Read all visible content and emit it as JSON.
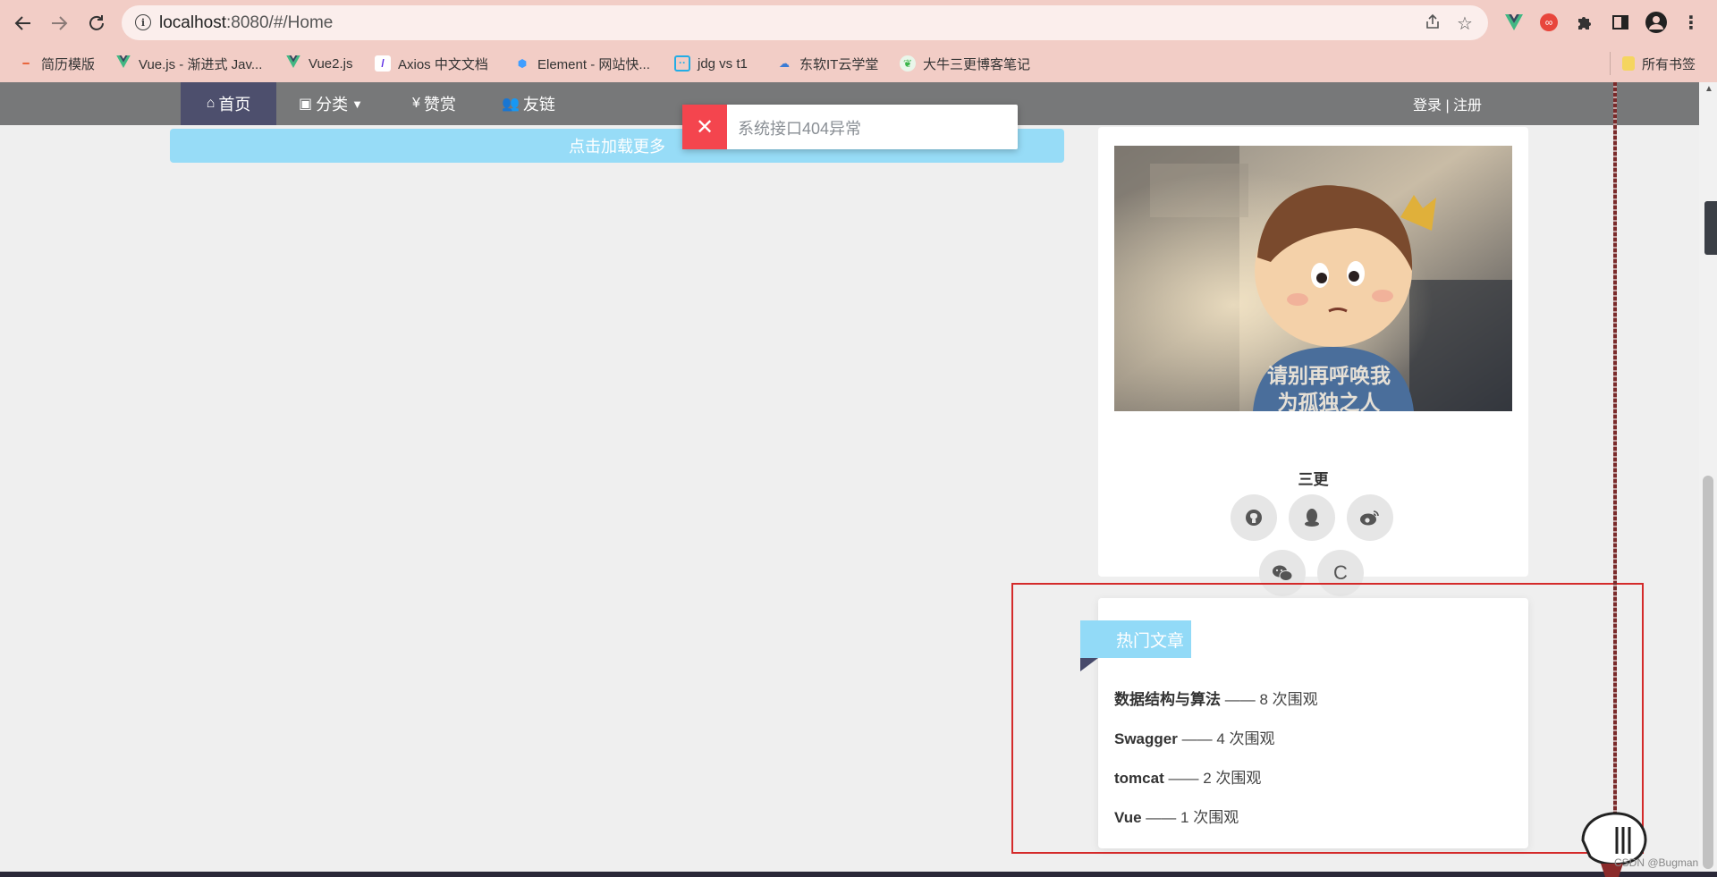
{
  "browser": {
    "url_host": "localhost",
    "url_rest": ":8080/#/Home",
    "bookmarks": [
      {
        "label": "简历模版",
        "icon": "dash-icon"
      },
      {
        "label": "Vue.js - 渐进式 Jav...",
        "icon": "vue-icon"
      },
      {
        "label": "Vue2.js",
        "icon": "vue-icon"
      },
      {
        "label": "Axios 中文文档",
        "icon": "axios-icon"
      },
      {
        "label": "Element - 网站快...",
        "icon": "element-icon"
      },
      {
        "label": "jdg vs t1",
        "icon": "bilibili-icon"
      },
      {
        "label": "东软IT云学堂",
        "icon": "cloud-icon"
      },
      {
        "label": "大牛三更博客笔记",
        "icon": "leaf-icon"
      }
    ],
    "all_bookmarks": "所有书签"
  },
  "nav": {
    "home": "首页",
    "category": "分类",
    "reward": "赞赏",
    "friends": "友链",
    "auth": "登录 | 注册"
  },
  "load_more": "点击加载更多",
  "toast": {
    "message": "系统接口404异常",
    "color": "#f4454e"
  },
  "profile": {
    "image_caption_line1": "请别再呼唤我",
    "image_caption_line2": "为孤独之人",
    "name": "三更",
    "socials": [
      "github-icon",
      "qq-icon",
      "weibo-icon",
      "wechat-icon",
      "csdn-icon"
    ],
    "csdn_label": "C"
  },
  "hot": {
    "title": "热门文章",
    "separator": " —— ",
    "unit": " 次围观",
    "items": [
      {
        "title": "数据结构与算法",
        "views": "8"
      },
      {
        "title": "Swagger",
        "views": "4"
      },
      {
        "title": "tomcat",
        "views": "2"
      },
      {
        "title": "Vue",
        "views": "1"
      }
    ]
  },
  "watermark": "CSDN @Bugman"
}
